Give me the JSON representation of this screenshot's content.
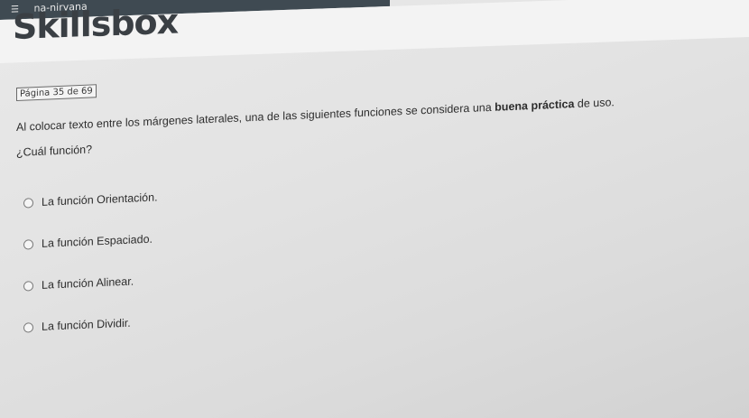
{
  "topbar": {
    "label": "na-nirvana"
  },
  "brand": {
    "logo_text": "Skillsbox"
  },
  "quiz": {
    "page_indicator": "Página 35 de 69",
    "question_before_bold": "Al colocar texto entre los márgenes laterales, una de las siguientes funciones se considera una ",
    "question_bold": "buena práctica",
    "question_after_bold": " de uso.",
    "sub_question": "¿Cuál función?",
    "options": [
      {
        "label": "La función Orientación."
      },
      {
        "label": "La función Espaciado."
      },
      {
        "label": "La función Alinear."
      },
      {
        "label": "La función Dividir."
      }
    ]
  },
  "colors": {
    "topbar_bg": "#3f4a52",
    "logo": "#3a3f44",
    "text": "#2d2d2d"
  }
}
